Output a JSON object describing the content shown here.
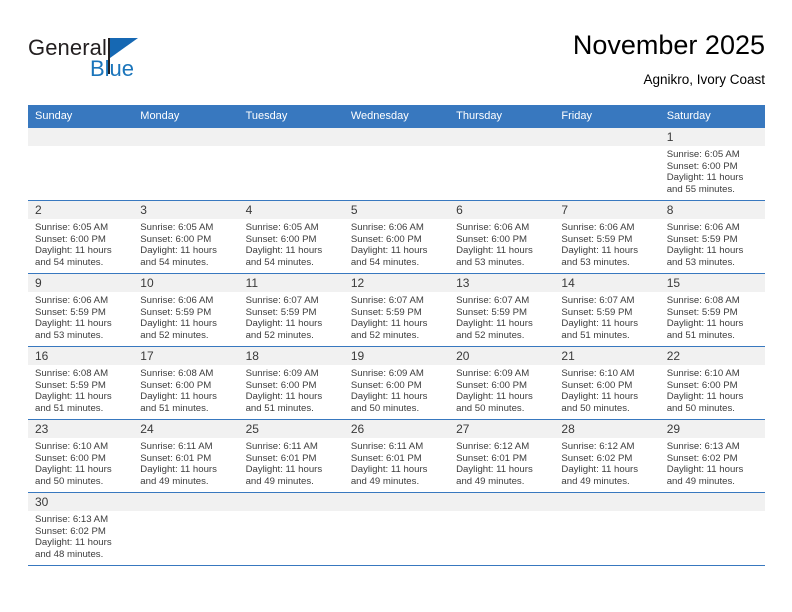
{
  "logo": {
    "word_one": "General",
    "word_two": "Blue",
    "triangle_color": "#1668b3",
    "blue_text_color": "#1b75bb"
  },
  "header": {
    "title": "November 2025",
    "subtitle": "Agnikro, Ivory Coast",
    "header_bg": "#3878bf",
    "header_text_color": "#ffffff"
  },
  "weekdays": [
    "Sunday",
    "Monday",
    "Tuesday",
    "Wednesday",
    "Thursday",
    "Friday",
    "Saturday"
  ],
  "labels": {
    "sunrise_prefix": "Sunrise:",
    "sunset_prefix": "Sunset:",
    "daylight_prefix": "Daylight:"
  },
  "weeks": [
    [
      {
        "blank": true
      },
      {
        "blank": true
      },
      {
        "blank": true
      },
      {
        "blank": true
      },
      {
        "blank": true
      },
      {
        "blank": true
      },
      {
        "day": "1",
        "sunrise": "Sunrise: 6:05 AM",
        "sunset": "Sunset: 6:00 PM",
        "daylight1": "Daylight: 11 hours",
        "daylight2": "and 55 minutes."
      }
    ],
    [
      {
        "day": "2",
        "sunrise": "Sunrise: 6:05 AM",
        "sunset": "Sunset: 6:00 PM",
        "daylight1": "Daylight: 11 hours",
        "daylight2": "and 54 minutes."
      },
      {
        "day": "3",
        "sunrise": "Sunrise: 6:05 AM",
        "sunset": "Sunset: 6:00 PM",
        "daylight1": "Daylight: 11 hours",
        "daylight2": "and 54 minutes."
      },
      {
        "day": "4",
        "sunrise": "Sunrise: 6:05 AM",
        "sunset": "Sunset: 6:00 PM",
        "daylight1": "Daylight: 11 hours",
        "daylight2": "and 54 minutes."
      },
      {
        "day": "5",
        "sunrise": "Sunrise: 6:06 AM",
        "sunset": "Sunset: 6:00 PM",
        "daylight1": "Daylight: 11 hours",
        "daylight2": "and 54 minutes."
      },
      {
        "day": "6",
        "sunrise": "Sunrise: 6:06 AM",
        "sunset": "Sunset: 6:00 PM",
        "daylight1": "Daylight: 11 hours",
        "daylight2": "and 53 minutes."
      },
      {
        "day": "7",
        "sunrise": "Sunrise: 6:06 AM",
        "sunset": "Sunset: 5:59 PM",
        "daylight1": "Daylight: 11 hours",
        "daylight2": "and 53 minutes."
      },
      {
        "day": "8",
        "sunrise": "Sunrise: 6:06 AM",
        "sunset": "Sunset: 5:59 PM",
        "daylight1": "Daylight: 11 hours",
        "daylight2": "and 53 minutes."
      }
    ],
    [
      {
        "day": "9",
        "sunrise": "Sunrise: 6:06 AM",
        "sunset": "Sunset: 5:59 PM",
        "daylight1": "Daylight: 11 hours",
        "daylight2": "and 53 minutes."
      },
      {
        "day": "10",
        "sunrise": "Sunrise: 6:06 AM",
        "sunset": "Sunset: 5:59 PM",
        "daylight1": "Daylight: 11 hours",
        "daylight2": "and 52 minutes."
      },
      {
        "day": "11",
        "sunrise": "Sunrise: 6:07 AM",
        "sunset": "Sunset: 5:59 PM",
        "daylight1": "Daylight: 11 hours",
        "daylight2": "and 52 minutes."
      },
      {
        "day": "12",
        "sunrise": "Sunrise: 6:07 AM",
        "sunset": "Sunset: 5:59 PM",
        "daylight1": "Daylight: 11 hours",
        "daylight2": "and 52 minutes."
      },
      {
        "day": "13",
        "sunrise": "Sunrise: 6:07 AM",
        "sunset": "Sunset: 5:59 PM",
        "daylight1": "Daylight: 11 hours",
        "daylight2": "and 52 minutes."
      },
      {
        "day": "14",
        "sunrise": "Sunrise: 6:07 AM",
        "sunset": "Sunset: 5:59 PM",
        "daylight1": "Daylight: 11 hours",
        "daylight2": "and 51 minutes."
      },
      {
        "day": "15",
        "sunrise": "Sunrise: 6:08 AM",
        "sunset": "Sunset: 5:59 PM",
        "daylight1": "Daylight: 11 hours",
        "daylight2": "and 51 minutes."
      }
    ],
    [
      {
        "day": "16",
        "sunrise": "Sunrise: 6:08 AM",
        "sunset": "Sunset: 5:59 PM",
        "daylight1": "Daylight: 11 hours",
        "daylight2": "and 51 minutes."
      },
      {
        "day": "17",
        "sunrise": "Sunrise: 6:08 AM",
        "sunset": "Sunset: 6:00 PM",
        "daylight1": "Daylight: 11 hours",
        "daylight2": "and 51 minutes."
      },
      {
        "day": "18",
        "sunrise": "Sunrise: 6:09 AM",
        "sunset": "Sunset: 6:00 PM",
        "daylight1": "Daylight: 11 hours",
        "daylight2": "and 51 minutes."
      },
      {
        "day": "19",
        "sunrise": "Sunrise: 6:09 AM",
        "sunset": "Sunset: 6:00 PM",
        "daylight1": "Daylight: 11 hours",
        "daylight2": "and 50 minutes."
      },
      {
        "day": "20",
        "sunrise": "Sunrise: 6:09 AM",
        "sunset": "Sunset: 6:00 PM",
        "daylight1": "Daylight: 11 hours",
        "daylight2": "and 50 minutes."
      },
      {
        "day": "21",
        "sunrise": "Sunrise: 6:10 AM",
        "sunset": "Sunset: 6:00 PM",
        "daylight1": "Daylight: 11 hours",
        "daylight2": "and 50 minutes."
      },
      {
        "day": "22",
        "sunrise": "Sunrise: 6:10 AM",
        "sunset": "Sunset: 6:00 PM",
        "daylight1": "Daylight: 11 hours",
        "daylight2": "and 50 minutes."
      }
    ],
    [
      {
        "day": "23",
        "sunrise": "Sunrise: 6:10 AM",
        "sunset": "Sunset: 6:00 PM",
        "daylight1": "Daylight: 11 hours",
        "daylight2": "and 50 minutes."
      },
      {
        "day": "24",
        "sunrise": "Sunrise: 6:11 AM",
        "sunset": "Sunset: 6:01 PM",
        "daylight1": "Daylight: 11 hours",
        "daylight2": "and 49 minutes."
      },
      {
        "day": "25",
        "sunrise": "Sunrise: 6:11 AM",
        "sunset": "Sunset: 6:01 PM",
        "daylight1": "Daylight: 11 hours",
        "daylight2": "and 49 minutes."
      },
      {
        "day": "26",
        "sunrise": "Sunrise: 6:11 AM",
        "sunset": "Sunset: 6:01 PM",
        "daylight1": "Daylight: 11 hours",
        "daylight2": "and 49 minutes."
      },
      {
        "day": "27",
        "sunrise": "Sunrise: 6:12 AM",
        "sunset": "Sunset: 6:01 PM",
        "daylight1": "Daylight: 11 hours",
        "daylight2": "and 49 minutes."
      },
      {
        "day": "28",
        "sunrise": "Sunrise: 6:12 AM",
        "sunset": "Sunset: 6:02 PM",
        "daylight1": "Daylight: 11 hours",
        "daylight2": "and 49 minutes."
      },
      {
        "day": "29",
        "sunrise": "Sunrise: 6:13 AM",
        "sunset": "Sunset: 6:02 PM",
        "daylight1": "Daylight: 11 hours",
        "daylight2": "and 49 minutes."
      }
    ],
    [
      {
        "day": "30",
        "sunrise": "Sunrise: 6:13 AM",
        "sunset": "Sunset: 6:02 PM",
        "daylight1": "Daylight: 11 hours",
        "daylight2": "and 48 minutes."
      },
      {
        "blank": true
      },
      {
        "blank": true
      },
      {
        "blank": true
      },
      {
        "blank": true
      },
      {
        "blank": true
      },
      {
        "blank": true
      }
    ]
  ]
}
